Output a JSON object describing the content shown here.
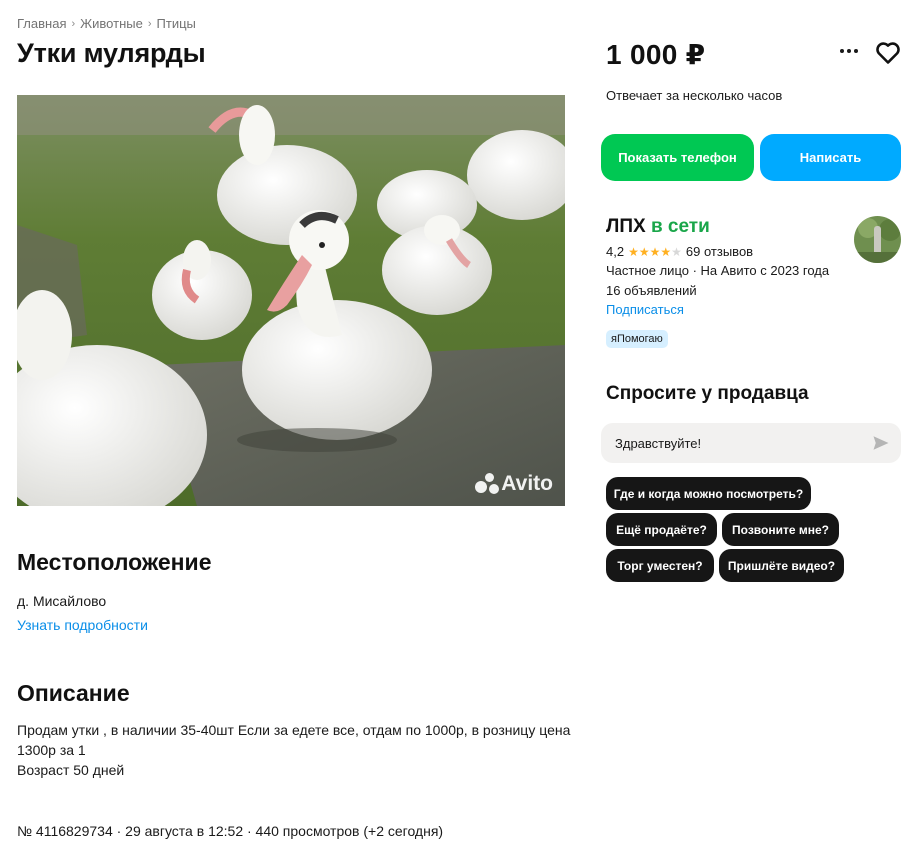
{
  "breadcrumb": {
    "items": [
      "Главная",
      "Животные",
      "Птицы"
    ],
    "separator": "›"
  },
  "listing": {
    "title": "Утки мулярды",
    "photo_watermark": "Avito"
  },
  "location": {
    "heading": "Местоположение",
    "place": "д. Мисайлово",
    "details_link": "Узнать подробности"
  },
  "description": {
    "heading": "Описание",
    "lines": [
      "Продам утки , в наличии 35-40шт Если за едете все, отдам по 1000р, в розницу цена 1300р за 1",
      "Возраст 50 дней"
    ]
  },
  "meta": {
    "text": "№ 4116829734 · 29 августа в 12:52 · 440 просмотров (+2 сегодня)"
  },
  "sidebar": {
    "price": "1 000 ₽",
    "responds": "Отвечает за несколько часов",
    "more_icon": "more-dots-icon",
    "favorite_icon": "heart-outline-icon",
    "show_phone_label": "Показать телефон",
    "write_label": "Написать",
    "colors": {
      "phone_button": "#00c853",
      "write_button": "#00aaff",
      "online": "#1aa64a",
      "link": "#0a8ee8",
      "star": "#ffb021"
    }
  },
  "seller": {
    "name": "ЛПХ",
    "status": "в сети",
    "rating": "4,2",
    "stars_filled": 4,
    "stars_total": 5,
    "reviews": "69 отзывов",
    "type": "Частное лицо · На Авито с 2023 года",
    "ads_count": "16 объявлений",
    "subscribe_label": "Подписаться",
    "badge": "яПомогаю"
  },
  "ask": {
    "heading": "Спросите у продавца",
    "input_value": "Здравствуйте!",
    "send_icon": "send-arrow-icon",
    "chips": [
      "Где и когда можно посмотреть?",
      "Ещё продаёте?",
      "Позвоните мне?",
      "Торг уместен?",
      "Пришлёте видео?"
    ]
  }
}
